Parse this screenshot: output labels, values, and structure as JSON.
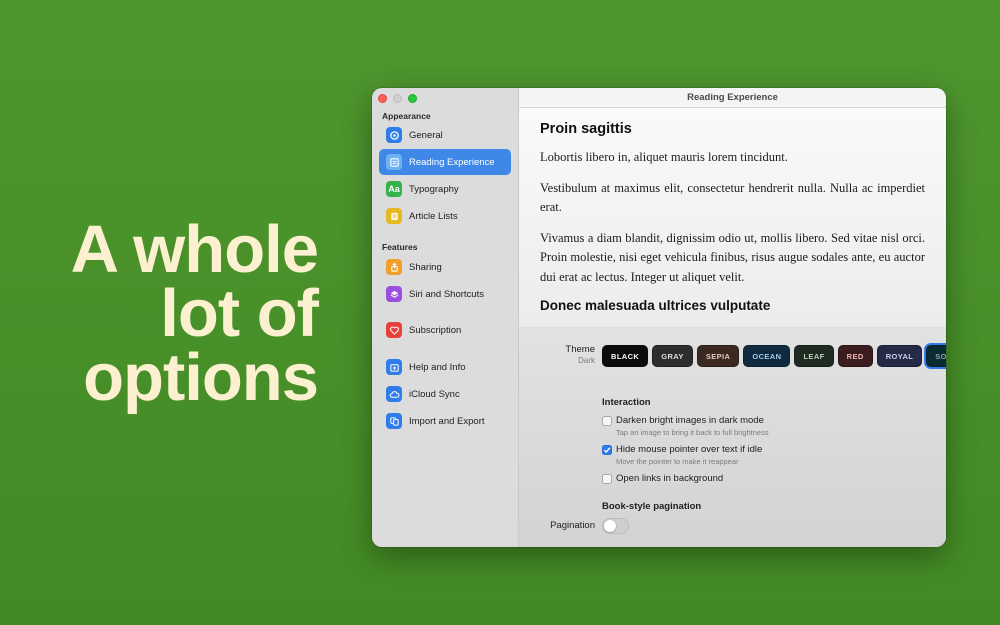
{
  "hero": {
    "line1": "A whole",
    "line2": "lot of",
    "line3": "options"
  },
  "window": {
    "title": "Reading Experience"
  },
  "sidebar": {
    "sections": [
      {
        "heading": "Appearance",
        "items": [
          {
            "label": "General",
            "icon": "gear-circle-icon",
            "color": "#2f7de8"
          },
          {
            "label": "Reading Experience",
            "icon": "reading-doc-icon",
            "color": "#5aa6f0",
            "active": true
          },
          {
            "label": "Typography",
            "icon": "typography-aa-icon",
            "icon_text": "Aa",
            "color": "#35b34a"
          },
          {
            "label": "Article Lists",
            "icon": "article-list-icon",
            "color": "#e6b922"
          }
        ]
      },
      {
        "heading": "Features",
        "items": [
          {
            "label": "Sharing",
            "icon": "share-icon",
            "color": "#f0a02a"
          },
          {
            "label": "Siri and Shortcuts",
            "icon": "shortcuts-icon",
            "color": "#9a4fe0"
          }
        ]
      },
      {
        "heading": "",
        "items": [
          {
            "label": "Subscription",
            "icon": "heart-icon",
            "color": "#e8403a"
          }
        ]
      },
      {
        "heading": "",
        "items": [
          {
            "label": "Help and Info",
            "icon": "help-info-icon",
            "color": "#2f7de8"
          },
          {
            "label": "iCloud Sync",
            "icon": "cloud-icon",
            "color": "#2f7de8"
          },
          {
            "label": "Import and Export",
            "icon": "import-export-icon",
            "color": "#2f7de8"
          }
        ]
      }
    ]
  },
  "preview": {
    "heading1": "Proin sagittis",
    "p1": "Lobortis libero in, aliquet mauris lorem tincidunt.",
    "p2": "Vestibulum at maximus elit, consectetur hendrerit nulla. Nulla ac im­perdiet erat.",
    "p3": "Vivamus a diam blandit, dignissim odio ut, mollis libero. Sed vitae nisl orci. Proin molestie, nisi eget vehicula finibus, risus augue sodales ante, eu auctor dui erat ac lectus. Integer ut aliquet velit.",
    "heading2": "Donec malesuada ultrices vulputate"
  },
  "settings": {
    "theme_label": "Theme",
    "theme_value": "Dark",
    "themes": [
      {
        "label": "BLACK",
        "bg": "#0c0c0c",
        "fg": "#ffffff"
      },
      {
        "label": "GRAY",
        "bg": "#2d2d2d",
        "fg": "#dcdcdc"
      },
      {
        "label": "SEPIA",
        "bg": "#3a2a22",
        "fg": "#e8cdb4"
      },
      {
        "label": "OCEAN",
        "bg": "#102a3f",
        "fg": "#9fcbea"
      },
      {
        "label": "LEAF",
        "bg": "#1f2a22",
        "fg": "#b9d4bb"
      },
      {
        "label": "RED",
        "bg": "#3b1d1f",
        "fg": "#eab4b4"
      },
      {
        "label": "ROYAL",
        "bg": "#252a46",
        "fg": "#c9cdf0"
      },
      {
        "label": "SOLARIZED",
        "bg": "#0b2b34",
        "fg": "#93a1a1",
        "selected": true
      }
    ],
    "interaction_title": "Interaction",
    "options": [
      {
        "label": "Darken bright images in dark mode",
        "sub": "Tap an image to bring it back to full brightness",
        "checked": false
      },
      {
        "label": "Hide mouse pointer over text if idle",
        "sub": "Move the pointer to make it reappear",
        "checked": true
      },
      {
        "label": "Open links in background",
        "sub": "",
        "checked": false
      }
    ],
    "pagination_title": "Book-style pagination",
    "pagination_label": "Pagination",
    "pagination_on": false
  }
}
